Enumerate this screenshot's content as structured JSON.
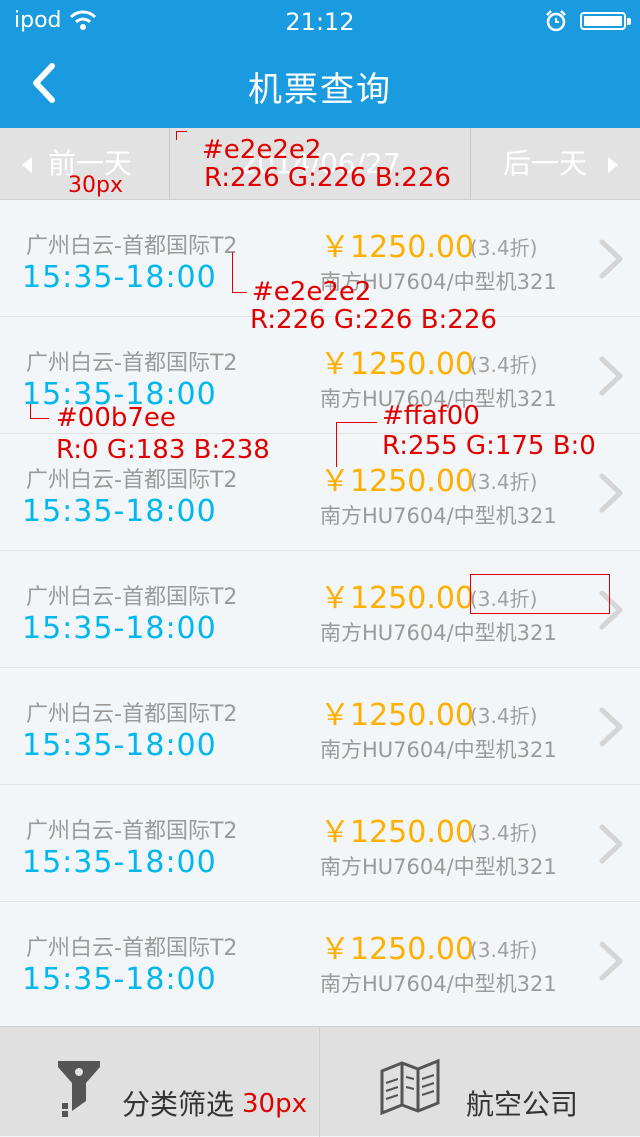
{
  "status_bar": {
    "carrier": "ipod",
    "time": "21:12",
    "wifi_icon": "wifi-icon",
    "alarm_icon": "alarm-icon",
    "battery_icon": "battery-icon"
  },
  "header": {
    "title": "机票查询",
    "back_icon": "back-arrow-icon",
    "background": "#1a9be0"
  },
  "date_bar": {
    "prev_label": "前一天",
    "next_label": "后一天",
    "date": "2014/06/27",
    "background": "#e2e2e2"
  },
  "flights": [
    {
      "route": "广州白云-首都国际T2",
      "times": "15:35-18:00",
      "price": "￥1250.00",
      "discount": "(3.4折)",
      "flight": "南方HU7604/中型机321"
    },
    {
      "route": "广州白云-首都国际T2",
      "times": "15:35-18:00",
      "price": "￥1250.00",
      "discount": "(3.4折)",
      "flight": "南方HU7604/中型机321"
    },
    {
      "route": "广州白云-首都国际T2",
      "times": "15:35-18:00",
      "price": "￥1250.00",
      "discount": "(3.4折)",
      "flight": "南方HU7604/中型机321"
    },
    {
      "route": "广州白云-首都国际T2",
      "times": "15:35-18:00",
      "price": "￥1250.00",
      "discount": "(3.4折)",
      "flight": "南方HU7604/中型机321"
    },
    {
      "route": "广州白云-首都国际T2",
      "times": "15:35-18:00",
      "price": "￥1250.00",
      "discount": "(3.4折)",
      "flight": "南方HU7604/中型机321"
    },
    {
      "route": "广州白云-首都国际T2",
      "times": "15:35-18:00",
      "price": "￥1250.00",
      "discount": "(3.4折)",
      "flight": "南方HU7604/中型机321"
    },
    {
      "route": "广州白云-首都国际T2",
      "times": "15:35-18:00",
      "price": "￥1250.00",
      "discount": "(3.4折)",
      "flight": "南方HU7604/中型机321"
    }
  ],
  "colors": {
    "time_blue": "#00b7ee",
    "price_orange": "#ffaf00",
    "divider": "#e2e2e2"
  },
  "annotations": {
    "datebar_font": "30px",
    "datebar_color_hex": "#e2e2e2",
    "datebar_color_rgb": "R:226 G:226 B:226",
    "divider_color_hex": "#e2e2e2",
    "divider_color_rgb": "R:226 G:226 B:226",
    "time_color_hex": "#00b7ee",
    "time_color_rgb": "R:0 G:183 B:238",
    "price_color_hex": "#ffaf00",
    "price_color_rgb": "R:255 G:175 B:0",
    "tab_font": "30px"
  },
  "tab_bar": {
    "filter_label": "分类筛选",
    "airline_label": "航空公司",
    "filter_icon": "filter-funnel-icon",
    "airline_icon": "map-buildings-icon"
  }
}
